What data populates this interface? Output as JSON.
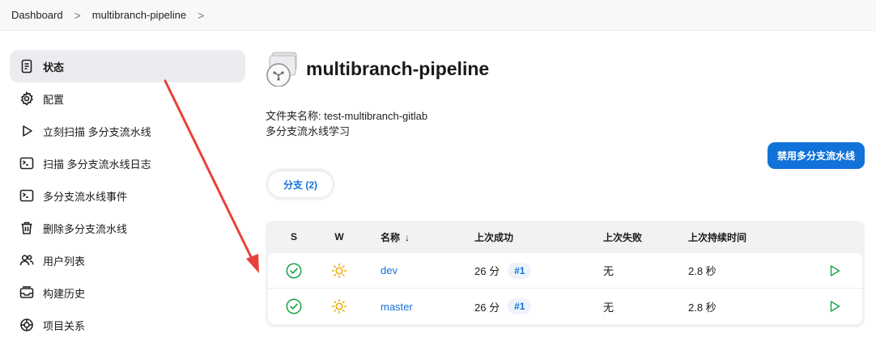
{
  "breadcrumb": {
    "items": [
      "Dashboard",
      "multibranch-pipeline"
    ],
    "separator": ">"
  },
  "sidebar": {
    "items": [
      {
        "label": "状态",
        "icon": "document-icon",
        "active": true
      },
      {
        "label": "配置",
        "icon": "gear-icon"
      },
      {
        "label": "立刻扫描 多分支流水线",
        "icon": "play-icon"
      },
      {
        "label": "扫描 多分支流水线日志",
        "icon": "terminal-icon"
      },
      {
        "label": "多分支流水线事件",
        "icon": "terminal-icon"
      },
      {
        "label": "删除多分支流水线",
        "icon": "trash-icon"
      },
      {
        "label": "用户列表",
        "icon": "users-icon"
      },
      {
        "label": "构建历史",
        "icon": "inbox-icon"
      },
      {
        "label": "项目关系",
        "icon": "network-icon"
      }
    ]
  },
  "main": {
    "title": "multibranch-pipeline",
    "folder_name_line": "文件夹名称: test-multibranch-gitlab",
    "description": "多分支流水线学习",
    "disable_button": "禁用多分支流水线",
    "tab_label": "分支 (2)",
    "table": {
      "headers": {
        "s": "S",
        "w": "W",
        "name": "名称",
        "sort_arrow": "↓",
        "last_success": "上次成功",
        "last_failure": "上次失败",
        "last_duration": "上次持续时间"
      },
      "rows": [
        {
          "name": "dev",
          "last_success": "26 分",
          "build": "#1",
          "last_failure": "无",
          "last_duration": "2.8 秒",
          "status": "success",
          "weather": "sunny"
        },
        {
          "name": "master",
          "last_success": "26 分",
          "build": "#1",
          "last_failure": "无",
          "last_duration": "2.8 秒",
          "status": "success",
          "weather": "sunny"
        }
      ]
    }
  },
  "colors": {
    "accent": "#1172d9",
    "success": "#1ea64b",
    "sun": "#f2a900",
    "annotation_arrow": "#e8413a"
  }
}
